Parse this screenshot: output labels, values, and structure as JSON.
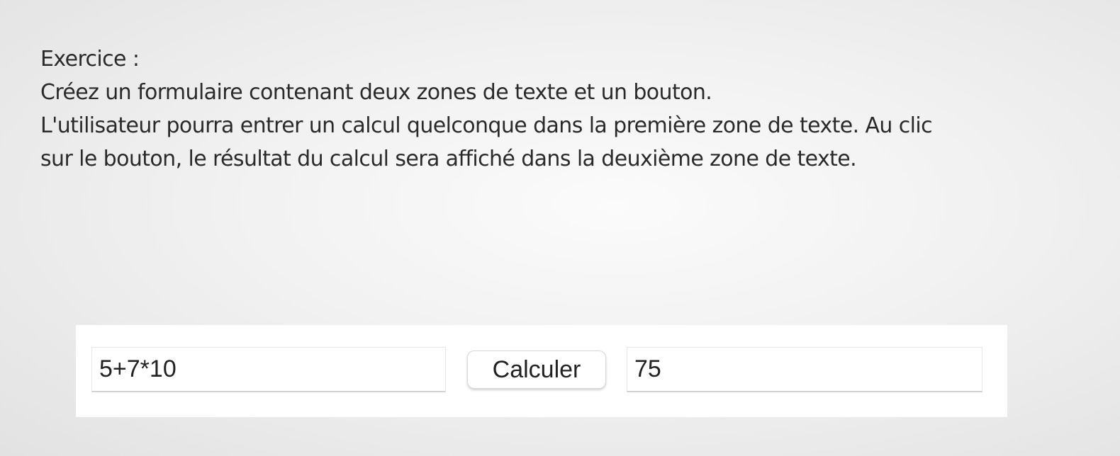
{
  "instructions": {
    "heading": "Exercice :",
    "line1": "Créez un formulaire contenant deux zones de texte et un bouton.",
    "line2": "L'utilisateur pourra entrer un calcul quelconque dans la première zone de texte. Au clic",
    "line3": "sur le bouton, le résultat du calcul sera affiché dans la deuxième zone de texte."
  },
  "form": {
    "input_value": "5+7*10",
    "button_label": "Calculer",
    "result_value": "75"
  }
}
